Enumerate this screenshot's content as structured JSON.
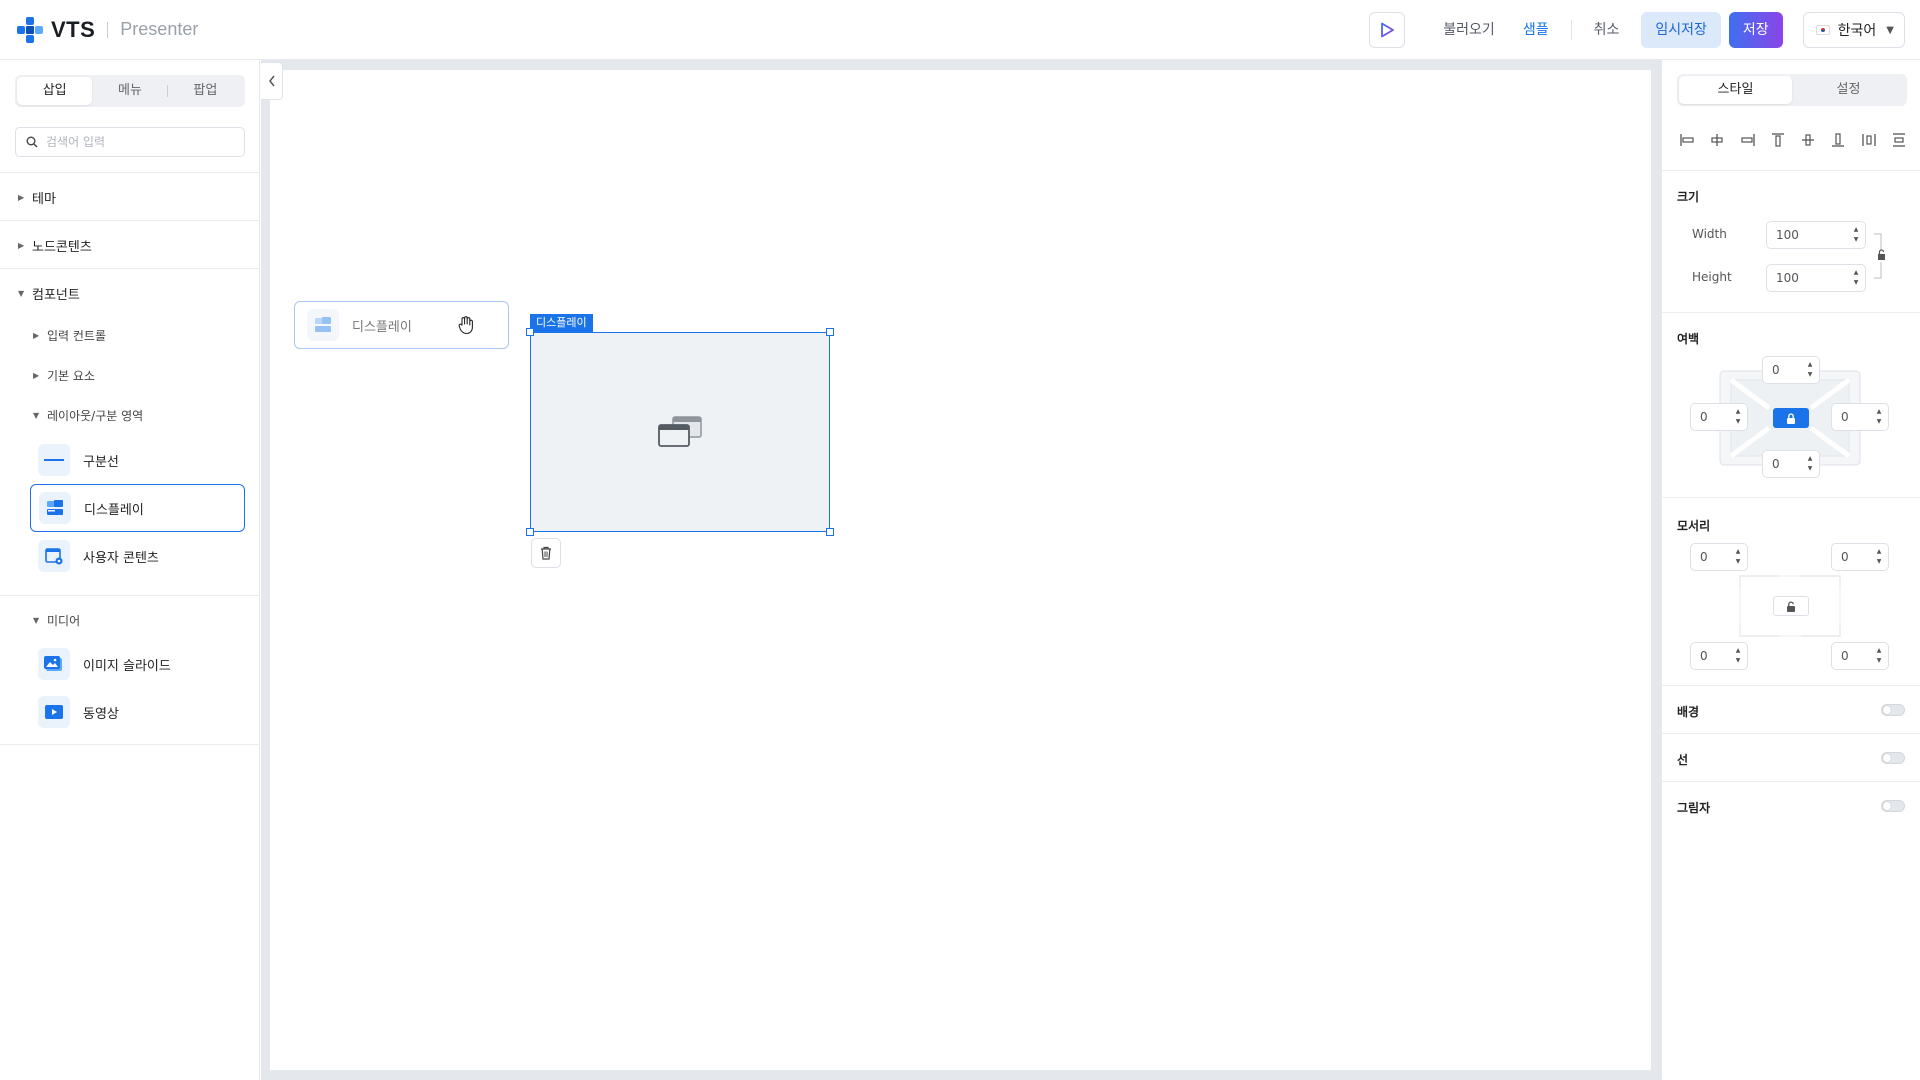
{
  "header": {
    "logo_text": "VTS",
    "product_name": "Presenter",
    "buttons": {
      "load": "불러오기",
      "sample": "샘플",
      "cancel": "취소",
      "temp_save": "임시저장",
      "save": "저장"
    },
    "language": "한국어"
  },
  "left_panel": {
    "tabs": [
      "삽입",
      "메뉴",
      "팝업"
    ],
    "active_tab": "삽입",
    "search_placeholder": "검색어 입력",
    "sections": {
      "theme": "테마",
      "node_contents": "노드콘텐츠",
      "components": "컴포넌트",
      "media": "미디어"
    },
    "subsections": {
      "input_controls": "입력 컨트롤",
      "basic_elements": "기본 요소",
      "layout_area": "레이아웃/구분 영역"
    },
    "items": {
      "divider": "구분선",
      "display": "디스플레이",
      "user_content": "사용자 콘텐츠",
      "image_slide": "이미지 슬라이드",
      "video": "동영상"
    },
    "selected_item": "디스플레이"
  },
  "canvas": {
    "drag_ghost_label": "디스플레이",
    "selected_component_label": "디스플레이"
  },
  "right_panel": {
    "tabs": [
      "스타일",
      "설정"
    ],
    "active_tab": "스타일",
    "size": {
      "title": "크기",
      "width_label": "Width",
      "width_value": "100",
      "height_label": "Height",
      "height_value": "100"
    },
    "margin": {
      "title": "여백",
      "top": "0",
      "left": "0",
      "right": "0",
      "bottom": "0"
    },
    "corner": {
      "title": "모서리",
      "top_left": "0",
      "top_right": "0",
      "bottom_left": "0",
      "bottom_right": "0"
    },
    "toggles": {
      "background": "배경",
      "border": "선",
      "shadow": "그림자"
    }
  },
  "colors": {
    "accent": "#1a73e8",
    "save_gradient_start": "#3f6ff0",
    "save_gradient_end": "#8b45e8"
  }
}
